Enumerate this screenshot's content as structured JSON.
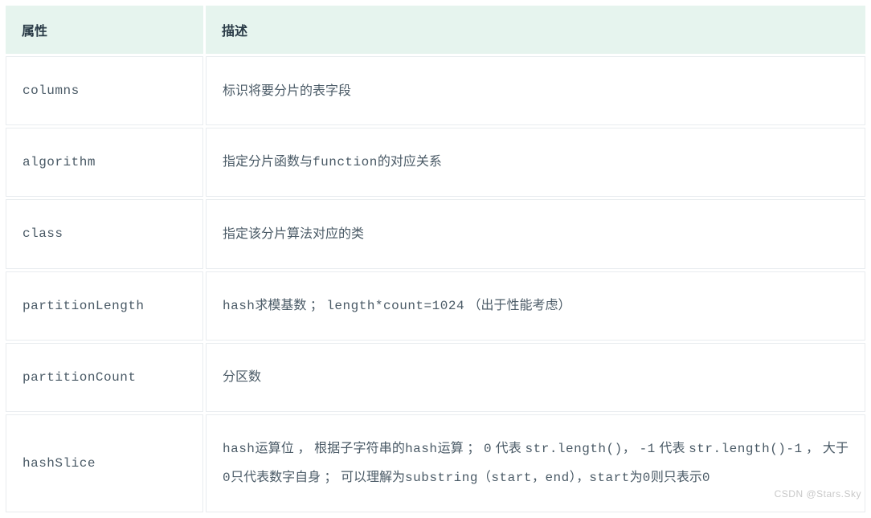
{
  "table": {
    "headers": {
      "attribute": "属性",
      "description": "描述"
    },
    "rows": [
      {
        "attr": "columns",
        "desc_parts": [
          {
            "type": "text",
            "value": "标识将要分片的表字段"
          }
        ]
      },
      {
        "attr": "algorithm",
        "desc_parts": [
          {
            "type": "text",
            "value": "指定分片函数与"
          },
          {
            "type": "mono",
            "value": "function"
          },
          {
            "type": "text",
            "value": "的对应关系"
          }
        ]
      },
      {
        "attr": "class",
        "desc_parts": [
          {
            "type": "text",
            "value": "指定该分片算法对应的类"
          }
        ]
      },
      {
        "attr": "partitionLength",
        "desc_parts": [
          {
            "type": "mono",
            "value": "hash"
          },
          {
            "type": "text",
            "value": "求模基数 ； "
          },
          {
            "type": "mono",
            "value": "length*count=1024"
          },
          {
            "type": "text",
            "value": " （出于性能考虑）"
          }
        ]
      },
      {
        "attr": "partitionCount",
        "desc_parts": [
          {
            "type": "text",
            "value": "分区数"
          }
        ]
      },
      {
        "attr": "hashSlice",
        "desc_parts": [
          {
            "type": "mono",
            "value": "hash"
          },
          {
            "type": "text",
            "value": "运算位 ， 根据子字符串的"
          },
          {
            "type": "mono",
            "value": "hash"
          },
          {
            "type": "text",
            "value": "运算 ； "
          },
          {
            "type": "mono",
            "value": "0"
          },
          {
            "type": "text",
            "value": " 代表 "
          },
          {
            "type": "mono",
            "value": "str.length()"
          },
          {
            "type": "text",
            "value": "， "
          },
          {
            "type": "mono",
            "value": "-1"
          },
          {
            "type": "text",
            "value": " 代表 "
          },
          {
            "type": "mono",
            "value": "str.length()-1"
          },
          {
            "type": "text",
            "value": " ， 大于"
          },
          {
            "type": "mono",
            "value": "0"
          },
          {
            "type": "text",
            "value": "只代表数字自身 ； 可以理解为"
          },
          {
            "type": "mono",
            "value": "substring（start，end）"
          },
          {
            "type": "text",
            "value": "，"
          },
          {
            "type": "mono",
            "value": "start"
          },
          {
            "type": "text",
            "value": "为"
          },
          {
            "type": "mono",
            "value": "0"
          },
          {
            "type": "text",
            "value": "则只表示"
          },
          {
            "type": "mono",
            "value": "0"
          }
        ]
      }
    ]
  },
  "watermark": "CSDN @Stars.Sky"
}
